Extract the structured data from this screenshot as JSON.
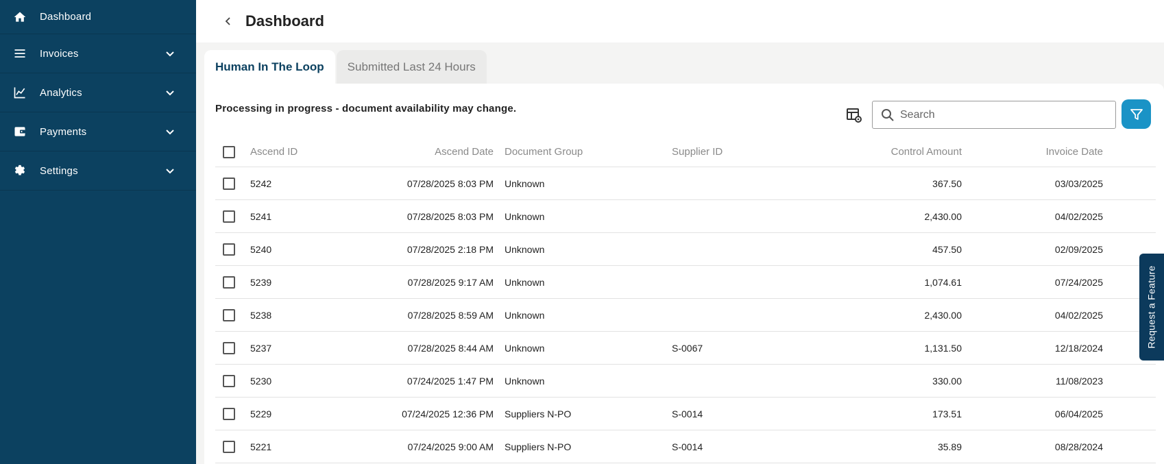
{
  "sidebar": {
    "items": [
      {
        "label": "Dashboard",
        "icon": "home-icon",
        "expandable": false
      },
      {
        "label": "Invoices",
        "icon": "menu-lines-icon",
        "expandable": true
      },
      {
        "label": "Analytics",
        "icon": "line-chart-icon",
        "expandable": true
      },
      {
        "label": "Payments",
        "icon": "wallet-icon",
        "expandable": true
      },
      {
        "label": "Settings",
        "icon": "gear-icon",
        "expandable": true
      }
    ]
  },
  "header": {
    "title": "Dashboard"
  },
  "tabs": [
    {
      "label": "Human In The Loop",
      "active": true
    },
    {
      "label": "Submitted Last 24 Hours",
      "active": false
    }
  ],
  "panel": {
    "notice": "Processing in progress - document availability may change.",
    "search": {
      "placeholder": "Search",
      "value": ""
    }
  },
  "table": {
    "columns": [
      "Ascend ID",
      "Ascend Date",
      "Document Group",
      "Supplier ID",
      "Control Amount",
      "Invoice Date"
    ],
    "rows": [
      [
        "5242",
        "07/28/2025 8:03 PM",
        "Unknown",
        "",
        "367.50",
        "03/03/2025"
      ],
      [
        "5241",
        "07/28/2025 8:03 PM",
        "Unknown",
        "",
        "2,430.00",
        "04/02/2025"
      ],
      [
        "5240",
        "07/28/2025 2:18 PM",
        "Unknown",
        "",
        "457.50",
        "02/09/2025"
      ],
      [
        "5239",
        "07/28/2025 9:17 AM",
        "Unknown",
        "",
        "1,074.61",
        "07/24/2025"
      ],
      [
        "5238",
        "07/28/2025 8:59 AM",
        "Unknown",
        "",
        "2,430.00",
        "04/02/2025"
      ],
      [
        "5237",
        "07/28/2025 8:44 AM",
        "Unknown",
        "S-0067",
        "1,131.50",
        "12/18/2024"
      ],
      [
        "5230",
        "07/24/2025 1:47 PM",
        "Unknown",
        "",
        "330.00",
        "11/08/2023"
      ],
      [
        "5229",
        "07/24/2025 12:36 PM",
        "Suppliers N-PO",
        "S-0014",
        "173.51",
        "06/04/2025"
      ],
      [
        "5221",
        "07/24/2025 9:00 AM",
        "Suppliers N-PO",
        "S-0014",
        "35.89",
        "08/28/2024"
      ]
    ]
  },
  "feature_tab": {
    "label": "Request a Feature"
  },
  "colors": {
    "sidebar": "#0c4160",
    "accent": "#1a93c6"
  }
}
